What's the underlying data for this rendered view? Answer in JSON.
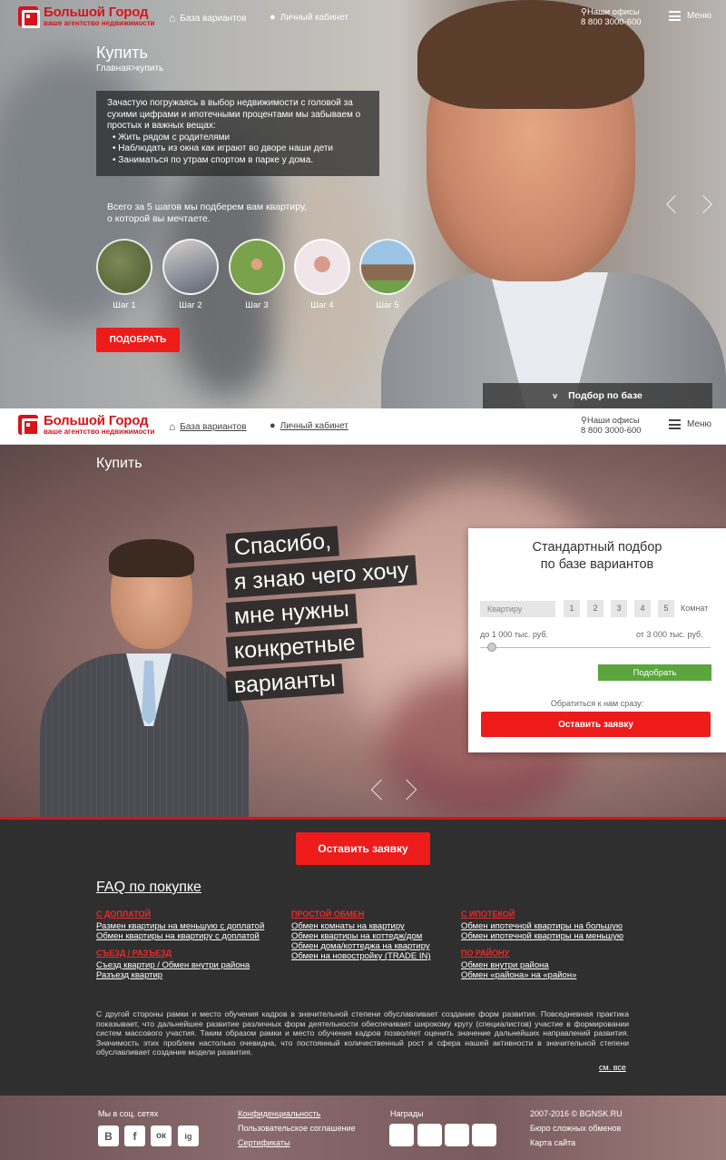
{
  "brand": {
    "name": "Большой Город",
    "tagline": "ваше агентство недвижимости"
  },
  "nav": {
    "base": "База вариантов",
    "cabinet": "Личный кабинет",
    "offices": "Наши офисы",
    "phone": "8 800 3000-600",
    "menu": "Меню"
  },
  "hero1": {
    "title": "Купить",
    "breadcrumb": "Главная>купить",
    "intro": "Зачастую погружаясь в выбор недвижимости с головой за сухими цифрами и ипотечными процентами мы забываем о простых и важных вещах:",
    "bullets": [
      "Жить рядом с родителями",
      "Наблюдать из окна как играют во дворе наши дети",
      "Заниматься по утрам спортом в парке у дома."
    ],
    "steps_text_1": "Всего за 5 шагов мы подберем вам квартиру,",
    "steps_text_2": "о которой вы мечтаете.",
    "steps": [
      "Шаг 1",
      "Шаг 2",
      "Шаг 3",
      "Шаг 4",
      "Шаг 5"
    ],
    "cta": "ПОДОБРАТЬ",
    "tab": "Подбор по базе"
  },
  "hero2": {
    "title": "Купить",
    "slogan": [
      "Спасибо,",
      "я знаю чего хочу",
      "мне нужны",
      "конкретные",
      "варианты"
    ]
  },
  "form": {
    "title_1": "Стандартный подбор",
    "title_2": "по базе вариантов",
    "select": "Квартиру",
    "rooms": [
      "1",
      "2",
      "3",
      "4",
      "5"
    ],
    "rooms_label": "Комнат",
    "price_from": "до 1 000 тыс. руб.",
    "price_to": "от 3 000 тыс. руб.",
    "submit": "Подобрать",
    "contact_text": "Обратиться к нам сразу:",
    "request": "Оставить заявку"
  },
  "dark": {
    "request": "Оставить заявку",
    "faq_title": "FAQ по покупке",
    "col1": {
      "cat1": "С ДОПЛАТОЙ",
      "links1": [
        "Размен квартиры на меньшую с доплатой",
        "Обмен квартиры на квартиру с доплатой"
      ],
      "cat2": "СЪЕЗД / РАЗЪЕЗД",
      "links2": [
        "Съезд квартир / Обмен внутри района",
        "Разъезд квартир"
      ]
    },
    "col2": {
      "cat1": "ПРОСТОЙ ОБМЕН",
      "links1": [
        "Обмен комнаты на квартиру",
        "Обмен квартиры на коттедж/дом",
        "Обмен дома/коттеджа на квартиру",
        "Обмен на новостройку (TRADE IN)"
      ]
    },
    "col3": {
      "cat1": "С ИПОТЕКОЙ",
      "links1": [
        "Обмен ипотечной квартиры на большую",
        "Обмен ипотечной квартиры на меньшую"
      ],
      "cat2": "ПО РАЙОНУ",
      "links2": [
        "Обмен внутри района",
        "Обмен «района» на «район»"
      ]
    },
    "paragraph": "С другой стороны рамки и место обучения кадров в значительной степени обуславливает создание форм развития. Повседневная практика показывает, что дальнейшее развитие различных форм деятельности обеспечивает широкому кругу (специалистов) участие в формировании систем массового участия. Таким образом рамки и место обучения кадров позволяет оценить значение дальнейших направлений развития. Значимость этих проблем настолько очевидна, что постоянный количественный рост и сфера нашей активности в значительной степени обуславливает создание модели развития.",
    "more": "см. все"
  },
  "footer": {
    "social_label": "Мы в соц. сетях",
    "social": [
      "В",
      "f",
      "ок",
      "ig"
    ],
    "links": [
      "Конфиденциальность",
      "Пользовательское соглашение",
      "Сертификаты"
    ],
    "awards_label": "Награды",
    "copyright": "2007-2016 © BGNSK.RU",
    "bureau": "Бюро сложных обменов",
    "sitemap": "Карта сайта"
  },
  "colors": {
    "accent": "#ee1b1b",
    "green": "#5aa53c",
    "dark": "#2f2f2f"
  }
}
